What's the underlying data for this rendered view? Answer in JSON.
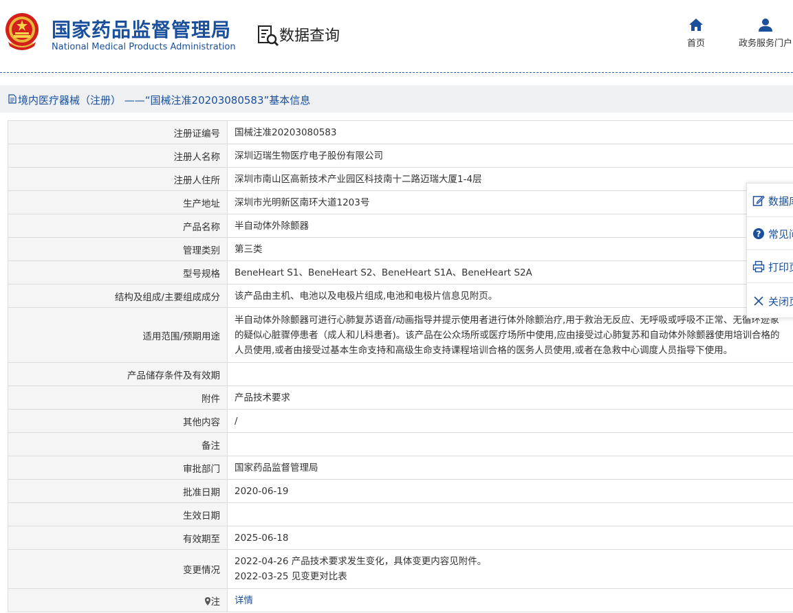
{
  "header": {
    "org_name_cn": "国家药品监督管理局",
    "org_name_en": "National Medical Products Administration",
    "section_title": "数据查询",
    "nav": [
      {
        "label": "首页",
        "icon": "home-icon"
      },
      {
        "label": "政务服务门户",
        "icon": "user-icon"
      }
    ]
  },
  "breadcrumb": {
    "text": "境内医疗器械（注册） ——“国械注准20203080583”基本信息"
  },
  "details": {
    "rows": [
      {
        "label": "注册证编号",
        "value": "国械注准20203080583"
      },
      {
        "label": "注册人名称",
        "value": "深圳迈瑞生物医疗电子股份有限公司"
      },
      {
        "label": "注册人住所",
        "value": "深圳市南山区高新技术产业园区科技南十二路迈瑞大厦1-4层"
      },
      {
        "label": "生产地址",
        "value": "深圳市光明新区南环大道1203号"
      },
      {
        "label": "产品名称",
        "value": "半自动体外除颤器"
      },
      {
        "label": "管理类别",
        "value": "第三类"
      },
      {
        "label": "型号规格",
        "value": "BeneHeart S1、BeneHeart S2、BeneHeart S1A、BeneHeart S2A"
      },
      {
        "label": "结构及组成/主要组成成分",
        "value": "该产品由主机、电池以及电极片组成,电池和电极片信息见附页。"
      },
      {
        "label": "适用范围/预期用途",
        "value_lines": [
          "半自动体外除颤器可进行心肺复苏语音/动画指导并提示使用者进行体外除颤治疗,用于救治无反应、无呼吸或呼吸不正常、无循环迹象",
          "的疑似心脏骤停患者（成人和儿科患者)。该产品在公众场所或医疗场所中使用,应由接受过心肺复苏和自动体外除颤器使用培训合格的",
          "人员使用,或者由接受过基本生命支持和高级生命支持课程培训合格的医务人员使用,或者在急救中心调度人员指导下使用。"
        ]
      },
      {
        "label": "产品储存条件及有效期",
        "value": ""
      },
      {
        "label": "附件",
        "value": "产品技术要求"
      },
      {
        "label": "其他内容",
        "value": "/"
      },
      {
        "label": "备注",
        "value": ""
      },
      {
        "label": "审批部门",
        "value": "国家药品监督管理局"
      },
      {
        "label": "批准日期",
        "value": "2020-06-19"
      },
      {
        "label": "生效日期",
        "value": ""
      },
      {
        "label": "有效期至",
        "value": "2025-06-18"
      },
      {
        "label": "变更情况",
        "value_lines": [
          "2022-04-26 产品技术要求发生变化，具体变更内容见附件。",
          "2022-03-25 见变更对比表"
        ]
      },
      {
        "label": "注",
        "value": "详情"
      }
    ]
  },
  "side_panel": {
    "items": [
      {
        "label": "数据库",
        "icon": "edit-icon"
      },
      {
        "label": "常见问",
        "icon": "help-icon"
      },
      {
        "label": "打印页",
        "icon": "print-icon"
      },
      {
        "label": "关闭页",
        "icon": "close-icon"
      }
    ]
  },
  "colors": {
    "brand_blue": "#1a4f9c",
    "label_bg": "#f5f5f5",
    "breadcrumb_bg": "#eef0f2"
  }
}
